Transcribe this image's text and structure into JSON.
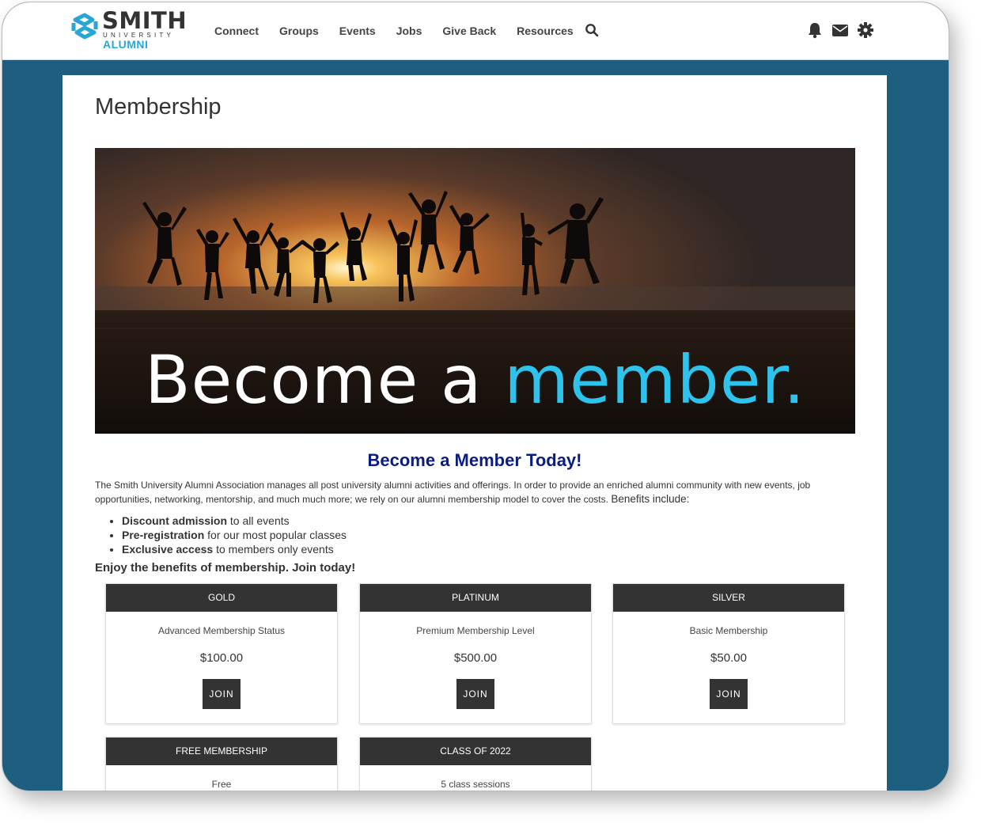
{
  "brand": {
    "name": "SMITH",
    "university": "UNIVERSITY",
    "alumni": "ALUMNI",
    "colors": {
      "accent": "#2aa6d6",
      "header_bg": "#1e5f80",
      "heading": "#0b1e7e",
      "dark": "#333333"
    }
  },
  "nav": {
    "links": [
      {
        "label": "Connect"
      },
      {
        "label": "Groups"
      },
      {
        "label": "Events"
      },
      {
        "label": "Jobs"
      },
      {
        "label": "Give Back"
      },
      {
        "label": "Resources"
      }
    ],
    "search_icon": "search-icon",
    "icons": [
      "bell-icon",
      "envelope-icon",
      "gear-icon"
    ]
  },
  "page": {
    "title": "Membership",
    "banner": {
      "text_plain": "Become a ",
      "text_accent": "member."
    },
    "heading": "Become a Member Today!",
    "intro": "The Smith University Alumni Association manages all post university alumni activities and offerings.  In order to provide an enriched alumni community with new events, job opportunities, networking, mentorship, and much much more; we rely on our alumni membership model to cover the costs.",
    "intro_tail": "Benefits include:",
    "benefits": [
      {
        "bold": "Discount admission",
        "rest": " to all events"
      },
      {
        "bold": "Pre-registration",
        "rest": " for our most popular classes"
      },
      {
        "bold": "Exclusive access",
        "rest": " to members only events"
      }
    ],
    "enjoy": "Enjoy the benefits of membership. Join today!"
  },
  "tiers": [
    {
      "name": "GOLD",
      "description": "Advanced Membership Status",
      "price": "$100.00",
      "button": "JOIN"
    },
    {
      "name": "PLATINUM",
      "description": "Premium Membership Level",
      "price": "$500.00",
      "button": "JOIN"
    },
    {
      "name": "SILVER",
      "description": "Basic Membership",
      "price": "$50.00",
      "button": "JOIN"
    },
    {
      "name": "FREE MEMBERSHIP",
      "description": "Free"
    },
    {
      "name": "CLASS OF 2022",
      "description": "5 class sessions"
    }
  ]
}
